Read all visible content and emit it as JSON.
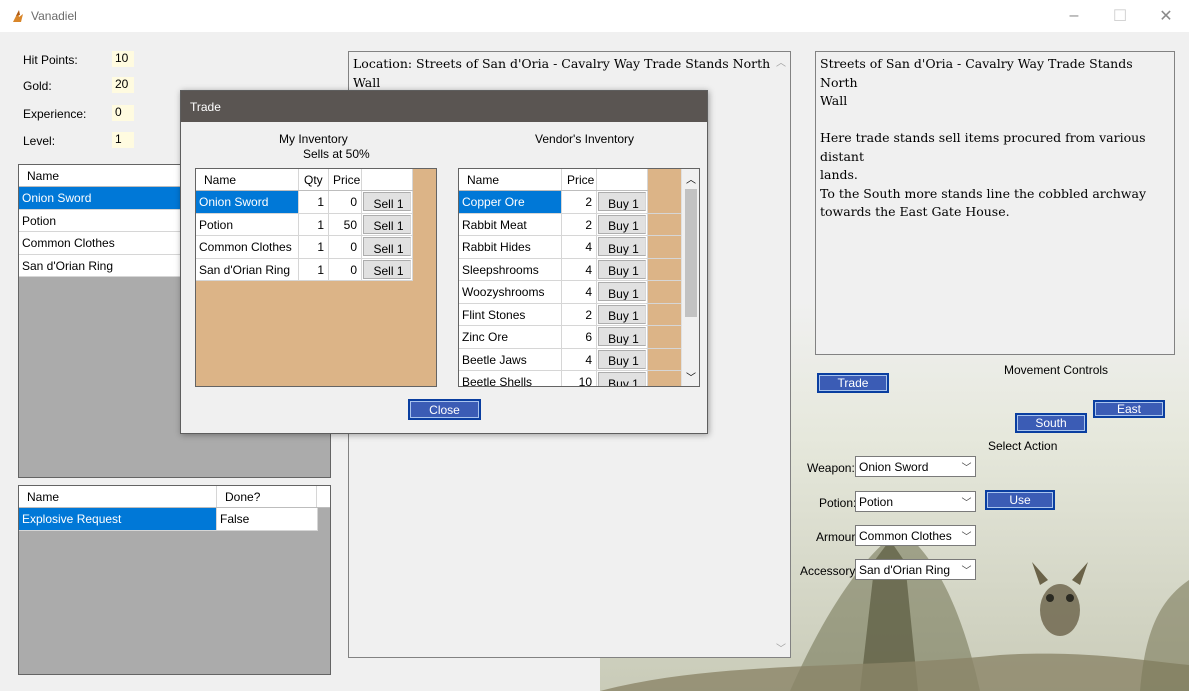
{
  "window": {
    "title": "Vanadiel",
    "controls": [
      "–",
      "☐",
      "✕"
    ]
  },
  "stats": [
    {
      "label": "Hit Points:",
      "value": "10"
    },
    {
      "label": "Gold:",
      "value": "20"
    },
    {
      "label": "Experience:",
      "value": "0"
    },
    {
      "label": "Level:",
      "value": "1"
    }
  ],
  "inventory": {
    "header": "Name",
    "items": [
      "Onion Sword",
      "Potion",
      "Common Clothes",
      "San d'Orian Ring"
    ]
  },
  "quests": {
    "headers": [
      "Name",
      "Done?"
    ],
    "rows": [
      {
        "name": "Explosive Request",
        "done": "False"
      }
    ]
  },
  "location_text": "Location: Streets of San d'Oria - Cavalry Way Trade Stands North\nWall",
  "description_text": "Streets of San d'Oria - Cavalry Way Trade Stands North\nWall\n\nHere trade stands sell items procured from various distant\nlands.\nTo the South more stands line the cobbled archway\ntowards the East Gate House.",
  "controls": {
    "trade_button": "Trade",
    "movement_label": "Movement Controls",
    "south_button": "South",
    "east_button": "East",
    "select_action_label": "Select Action",
    "weapon_label": "Weapon:",
    "weapon_value": "Onion Sword",
    "potion_label": "Potion:",
    "potion_value": "Potion",
    "use_button": "Use",
    "armour_label": "Armour:",
    "armour_value": "Common Clothes",
    "accessory_label": "Accessory:",
    "accessory_value": "San d'Orian Ring"
  },
  "trade": {
    "title": "Trade",
    "my_inventory_label": "My Inventory",
    "sells_at_label": "Sells at 50%",
    "vendor_label": "Vendor's Inventory",
    "my_headers": [
      "Name",
      "Qty",
      "Price",
      ""
    ],
    "my_items": [
      {
        "name": "Onion Sword",
        "qty": "1",
        "price": "0",
        "action": "Sell 1"
      },
      {
        "name": "Potion",
        "qty": "1",
        "price": "50",
        "action": "Sell 1"
      },
      {
        "name": "Common Clothes",
        "qty": "1",
        "price": "0",
        "action": "Sell 1"
      },
      {
        "name": "San d'Orian Ring",
        "qty": "1",
        "price": "0",
        "action": "Sell 1"
      }
    ],
    "vendor_headers": [
      "Name",
      "Price",
      ""
    ],
    "vendor_items": [
      {
        "name": "Copper Ore",
        "price": "2",
        "action": "Buy 1"
      },
      {
        "name": "Rabbit Meat",
        "price": "2",
        "action": "Buy 1"
      },
      {
        "name": "Rabbit Hides",
        "price": "4",
        "action": "Buy 1"
      },
      {
        "name": "Sleepshrooms",
        "price": "4",
        "action": "Buy 1"
      },
      {
        "name": "Woozyshrooms",
        "price": "4",
        "action": "Buy 1"
      },
      {
        "name": "Flint Stones",
        "price": "2",
        "action": "Buy 1"
      },
      {
        "name": "Zinc Ore",
        "price": "6",
        "action": "Buy 1"
      },
      {
        "name": "Beetle Jaws",
        "price": "4",
        "action": "Buy 1"
      },
      {
        "name": "Beetle Shells",
        "price": "10",
        "action": "Buy 1"
      }
    ],
    "close_button": "Close"
  },
  "colors": {
    "selection": "#0078d7",
    "button_blue": "#3b5cb5",
    "grid_tan": "#dcb487",
    "stat_bg": "#fffbe0"
  }
}
